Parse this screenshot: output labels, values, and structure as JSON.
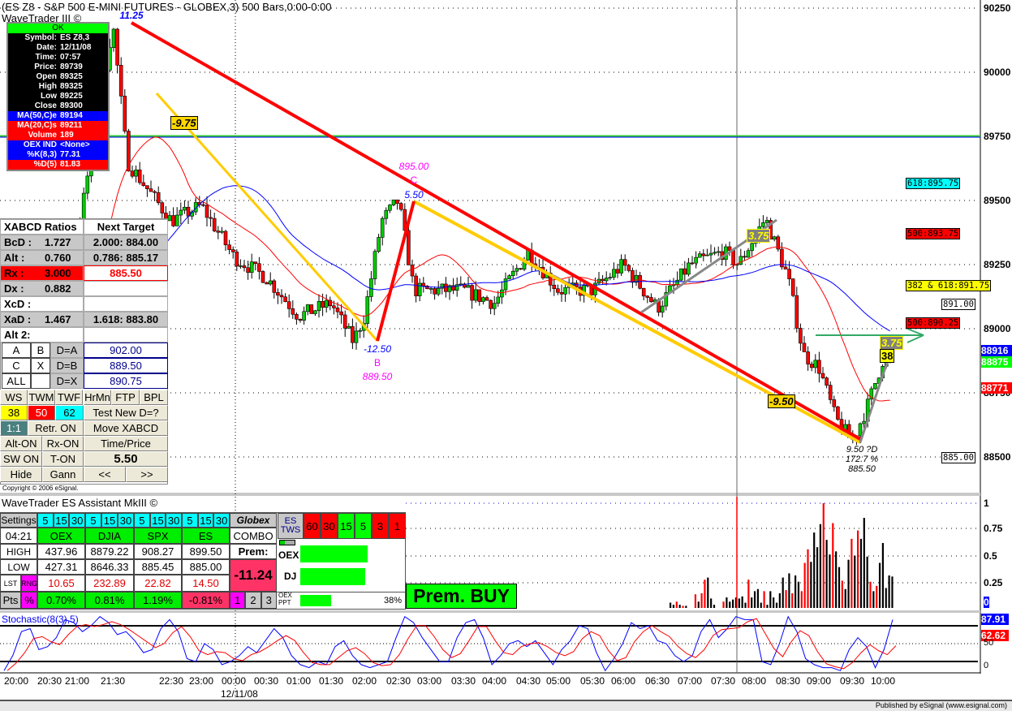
{
  "header": {
    "title": "(ES Z8 - S&P 500 E-MINI FUTURES - GLOBEX,3) 500 Bars,0:00-0:00",
    "study": "WaveTrader III ©"
  },
  "info_box": {
    "status": "OK",
    "rows": [
      [
        "Symbol:",
        "ES Z8,3"
      ],
      [
        "Date:",
        "12/11/08"
      ],
      [
        "Time:",
        "07:57"
      ],
      [
        "Price:",
        "89739"
      ],
      [
        "Open",
        "89325"
      ],
      [
        "High",
        "89325"
      ],
      [
        "Low",
        "89225"
      ],
      [
        "Close",
        "89300"
      ],
      [
        "MA(50,C)e",
        "89194"
      ],
      [
        "MA(20,C)s",
        "89211"
      ],
      [
        "Volume",
        "189"
      ],
      [
        "OEX IND",
        "<None>"
      ],
      [
        "%K(8,3)",
        "77.31"
      ],
      [
        "%D(5)",
        "81.83"
      ]
    ]
  },
  "xabcd": {
    "rows": [
      [
        "XABCD Ratios",
        "",
        "Next Target"
      ],
      [
        "BcD :",
        "1.727",
        "2.000: 884.00"
      ],
      [
        "Alt  :",
        "0.760",
        "0.786: 885.17"
      ],
      [
        "Rx  :",
        "3.000",
        "885.50"
      ],
      [
        "Dx  :",
        "0.882",
        ""
      ],
      [
        "XcD :",
        "",
        ""
      ],
      [
        "XaD :",
        "1.467",
        "1.618: 883.80"
      ],
      [
        "Alt 2:",
        "",
        ""
      ]
    ],
    "mode_rows": [
      [
        "A",
        "B",
        "D=A",
        "902.00"
      ],
      [
        "C",
        "X",
        "D=B",
        "889.50"
      ],
      [
        "ALL",
        "",
        "D=X",
        "890.75"
      ]
    ],
    "buttons": [
      [
        "WS",
        "TWM",
        "TWF",
        "HrMn",
        "FTP",
        "BPL"
      ],
      [
        "38",
        "50",
        "62",
        "Test New D=?"
      ],
      [
        "1:1",
        "Retr. ON",
        "Move XABCD"
      ],
      [
        "Alt-ON",
        "Rx-ON",
        "Time/Price"
      ],
      [
        "SW ON",
        "T-ON",
        "5.50"
      ],
      [
        "Hide",
        "Gann",
        "<<",
        ">>"
      ]
    ],
    "copyright": "Copyright © 2006 eSignal."
  },
  "assistant": {
    "title": "WaveTrader ES Assistant MkIII ©",
    "settings": "Settings",
    "periods": [
      "5",
      "15",
      "30"
    ],
    "globex": "Globex",
    "time": "04:21",
    "symbols": [
      "OEX",
      "DJIA",
      "SPX",
      "ES"
    ],
    "combo": "COMBO",
    "high_label": "HIGH",
    "low_label": "LOW",
    "lst": "LST",
    "rng": "RNG",
    "pts": "Pts",
    "pct": "%",
    "high": [
      "437.96",
      "8879.22",
      "908.27",
      "899.50"
    ],
    "low": [
      "427.31",
      "8646.33",
      "885.45",
      "885.00"
    ],
    "range": [
      "10.65",
      "232.89",
      "22.82",
      "14.50"
    ],
    "change": [
      "0.70%",
      "0.81%",
      "1.19%",
      "-0.81%"
    ],
    "prem_label": "Prem:",
    "prem_value": "-11.24",
    "pages": [
      "1",
      "2",
      "3"
    ],
    "tws_label": "ES TWS",
    "tws": [
      {
        "v": "60",
        "c": "#ff0000"
      },
      {
        "v": "30",
        "c": "#ff0000"
      },
      {
        "v": "15",
        "c": "#00ff00"
      },
      {
        "v": "5",
        "c": "#00ff00"
      },
      {
        "v": "3",
        "c": "#ff0000"
      },
      {
        "v": "1",
        "c": "#ff0000"
      }
    ],
    "oex_label": "OEX",
    "dj_label": "DJ",
    "ppt_label": "OEX PPT",
    "ppt_pct": "38%",
    "signal": "Prem. BUY"
  },
  "chart_data": {
    "type": "candlestick",
    "title": "(ES Z8 - S&P 500 E-MINI FUTURES - GLOBEX,3) 500 Bars,0:00-0:00",
    "ylim": [
      88400,
      90300
    ],
    "y_ticks": [
      "90250",
      "90000",
      "89750",
      "89500",
      "89250",
      "89000",
      "88750",
      "88500"
    ],
    "x_ticks": [
      "20:00",
      "20:30",
      "21:00",
      "21:30",
      "22:30",
      "23:00",
      "00:00",
      "00:30",
      "01:00",
      "01:30",
      "02:00",
      "02:30",
      "03:00",
      "03:30",
      "04:00",
      "04:30",
      "05:00",
      "05:30",
      "06:00",
      "06:30",
      "07:00",
      "07:30",
      "08:00",
      "08:30",
      "09:00",
      "09:30",
      "10:00"
    ],
    "date_label": "12/11/08",
    "price_path": [
      [
        "20:00",
        88650
      ],
      [
        "20:30",
        89000
      ],
      [
        "21:00",
        89350
      ],
      [
        "21:30",
        90190
      ],
      [
        "21:45",
        89650
      ],
      [
        "22:30",
        89420
      ],
      [
        "23:00",
        89480
      ],
      [
        "00:00",
        89280
      ],
      [
        "00:30",
        89200
      ],
      [
        "01:00",
        89050
      ],
      [
        "01:30",
        89100
      ],
      [
        "01:50",
        88950
      ],
      [
        "02:00",
        89050
      ],
      [
        "02:15",
        89420
      ],
      [
        "02:30",
        89500
      ],
      [
        "02:45",
        89150
      ],
      [
        "03:30",
        89150
      ],
      [
        "04:00",
        89100
      ],
      [
        "04:30",
        89300
      ],
      [
        "05:00",
        89150
      ],
      [
        "05:30",
        89150
      ],
      [
        "06:00",
        89250
      ],
      [
        "06:30",
        89080
      ],
      [
        "07:00",
        89250
      ],
      [
        "07:30",
        89300
      ],
      [
        "07:45",
        89250
      ],
      [
        "08:10",
        89430
      ],
      [
        "08:30",
        89200
      ],
      [
        "08:45",
        88900
      ],
      [
        "09:00",
        88850
      ],
      [
        "09:15",
        88650
      ],
      [
        "09:30",
        88560
      ],
      [
        "09:45",
        88700
      ],
      [
        "10:00",
        88880
      ]
    ],
    "levels": {
      "hline": "89750",
      "tags": [
        {
          "t": "618:895.75",
          "c": "#00ffff"
        },
        {
          "t": "500:893.75",
          "c": "#ff0000"
        },
        {
          "t": "382 & 618:891.75",
          "c": "#ffff00"
        },
        {
          "t": "891.00",
          "c": "#ffffff"
        },
        {
          "t": "500:890.25",
          "c": "#ff0000"
        },
        {
          "t": "885.00",
          "c": "#ffffff"
        }
      ],
      "last": [
        {
          "t": "88916",
          "c": "#0000ff"
        },
        {
          "t": "88875",
          "c": "#00ff00"
        },
        {
          "t": "88771",
          "c": "#ff0000"
        }
      ]
    },
    "annotations": {
      "peak": "11.25",
      "xa": "-9.75",
      "c_price": "895.00",
      "c": "C",
      "c_move": "5.50",
      "b_move": "-12.50",
      "b": "B",
      "b_price": "889.50",
      "swing1": "3.75",
      "cd": "-9.50",
      "d1": "9.50 ?D",
      "d2": "172.7 %",
      "d3": "885.50",
      "swing2": "3.75",
      "fib": "38"
    },
    "volume": {
      "y_ticks": [
        "1",
        "0.75",
        "0.5",
        "0.25",
        "0"
      ],
      "values": [
        0.05,
        0.03,
        0.06,
        0.03,
        0.02,
        0.02,
        0,
        0,
        0.13,
        0.06,
        0.14,
        0.27,
        0.29,
        0.09,
        0.03,
        0,
        0,
        0.06,
        0.1,
        0.06,
        0.08,
        0.1,
        0.09,
        0.11,
        0.05,
        0.27,
        0.1,
        0.16,
        0.18,
        0.05,
        0.16,
        0.03,
        0.16,
        0.1,
        0.05,
        0.14,
        0.29,
        0.17,
        0.33,
        0.14,
        0.31,
        0.25,
        0.16,
        0.43,
        0.56,
        0.44,
        0.72,
        0.58,
        0.8,
        1.0,
        0.65,
        0.51,
        0.81,
        0.54,
        0.39,
        0.26,
        0.18,
        0.46,
        0.66,
        0.5,
        0.74,
        0.66,
        0.86,
        0.49,
        0.25,
        0.16,
        0.21,
        0.43,
        0.62,
        0.19,
        0.31,
        0.3
      ],
      "colors": "bbrbrbbbrbrrbbbbbrbbbbbbbrbbbbrbbbbbbrbrbbrrrbbbbrbbrbbrbbrbrbbbrbrbbb"
    },
    "stochastic": {
      "label": "Stochastic(8(3),5)",
      "k_last": "87.91",
      "d_last": "62.62",
      "y_ticks": [
        "50",
        "0"
      ],
      "k": [
        5,
        30,
        70,
        75,
        40,
        45,
        60,
        90,
        85,
        70,
        80,
        95,
        85,
        65,
        70,
        55,
        35,
        40,
        75,
        90,
        70,
        25,
        20,
        50,
        40,
        15,
        20,
        30,
        45,
        35,
        55,
        75,
        60,
        30,
        15,
        10,
        20,
        15,
        45,
        55,
        30,
        15,
        10,
        15,
        20,
        60,
        95,
        85,
        60,
        40,
        20,
        20,
        60,
        85,
        90,
        60,
        15,
        30,
        50,
        55,
        45,
        55,
        35,
        15,
        40,
        55,
        80,
        75,
        35,
        5,
        25,
        50,
        85,
        75,
        80,
        55,
        50,
        30,
        20,
        30,
        70,
        90,
        60,
        75,
        95,
        90,
        90,
        20,
        15,
        50,
        95,
        70,
        25,
        15,
        10,
        10,
        5,
        40,
        60,
        45,
        10,
        40,
        90
      ]
    }
  },
  "footer": "Published by eSignal (www.esignal.com)"
}
